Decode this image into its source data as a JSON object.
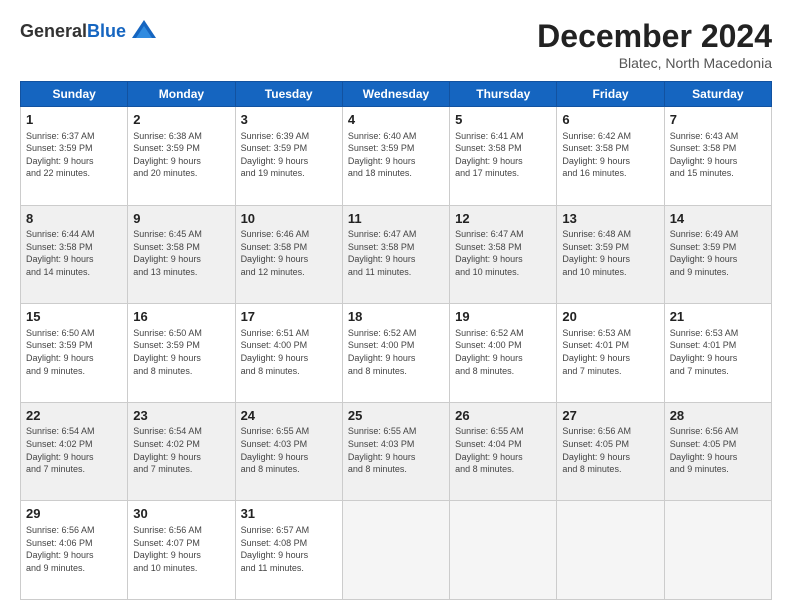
{
  "header": {
    "logo_general": "General",
    "logo_blue": "Blue",
    "month_year": "December 2024",
    "location": "Blatec, North Macedonia"
  },
  "weekdays": [
    "Sunday",
    "Monday",
    "Tuesday",
    "Wednesday",
    "Thursday",
    "Friday",
    "Saturday"
  ],
  "weeks": [
    [
      {
        "day": "1",
        "info": "Sunrise: 6:37 AM\nSunset: 3:59 PM\nDaylight: 9 hours\nand 22 minutes."
      },
      {
        "day": "2",
        "info": "Sunrise: 6:38 AM\nSunset: 3:59 PM\nDaylight: 9 hours\nand 20 minutes."
      },
      {
        "day": "3",
        "info": "Sunrise: 6:39 AM\nSunset: 3:59 PM\nDaylight: 9 hours\nand 19 minutes."
      },
      {
        "day": "4",
        "info": "Sunrise: 6:40 AM\nSunset: 3:59 PM\nDaylight: 9 hours\nand 18 minutes."
      },
      {
        "day": "5",
        "info": "Sunrise: 6:41 AM\nSunset: 3:58 PM\nDaylight: 9 hours\nand 17 minutes."
      },
      {
        "day": "6",
        "info": "Sunrise: 6:42 AM\nSunset: 3:58 PM\nDaylight: 9 hours\nand 16 minutes."
      },
      {
        "day": "7",
        "info": "Sunrise: 6:43 AM\nSunset: 3:58 PM\nDaylight: 9 hours\nand 15 minutes."
      }
    ],
    [
      {
        "day": "8",
        "info": "Sunrise: 6:44 AM\nSunset: 3:58 PM\nDaylight: 9 hours\nand 14 minutes."
      },
      {
        "day": "9",
        "info": "Sunrise: 6:45 AM\nSunset: 3:58 PM\nDaylight: 9 hours\nand 13 minutes."
      },
      {
        "day": "10",
        "info": "Sunrise: 6:46 AM\nSunset: 3:58 PM\nDaylight: 9 hours\nand 12 minutes."
      },
      {
        "day": "11",
        "info": "Sunrise: 6:47 AM\nSunset: 3:58 PM\nDaylight: 9 hours\nand 11 minutes."
      },
      {
        "day": "12",
        "info": "Sunrise: 6:47 AM\nSunset: 3:58 PM\nDaylight: 9 hours\nand 10 minutes."
      },
      {
        "day": "13",
        "info": "Sunrise: 6:48 AM\nSunset: 3:59 PM\nDaylight: 9 hours\nand 10 minutes."
      },
      {
        "day": "14",
        "info": "Sunrise: 6:49 AM\nSunset: 3:59 PM\nDaylight: 9 hours\nand 9 minutes."
      }
    ],
    [
      {
        "day": "15",
        "info": "Sunrise: 6:50 AM\nSunset: 3:59 PM\nDaylight: 9 hours\nand 9 minutes."
      },
      {
        "day": "16",
        "info": "Sunrise: 6:50 AM\nSunset: 3:59 PM\nDaylight: 9 hours\nand 8 minutes."
      },
      {
        "day": "17",
        "info": "Sunrise: 6:51 AM\nSunset: 4:00 PM\nDaylight: 9 hours\nand 8 minutes."
      },
      {
        "day": "18",
        "info": "Sunrise: 6:52 AM\nSunset: 4:00 PM\nDaylight: 9 hours\nand 8 minutes."
      },
      {
        "day": "19",
        "info": "Sunrise: 6:52 AM\nSunset: 4:00 PM\nDaylight: 9 hours\nand 8 minutes."
      },
      {
        "day": "20",
        "info": "Sunrise: 6:53 AM\nSunset: 4:01 PM\nDaylight: 9 hours\nand 7 minutes."
      },
      {
        "day": "21",
        "info": "Sunrise: 6:53 AM\nSunset: 4:01 PM\nDaylight: 9 hours\nand 7 minutes."
      }
    ],
    [
      {
        "day": "22",
        "info": "Sunrise: 6:54 AM\nSunset: 4:02 PM\nDaylight: 9 hours\nand 7 minutes."
      },
      {
        "day": "23",
        "info": "Sunrise: 6:54 AM\nSunset: 4:02 PM\nDaylight: 9 hours\nand 7 minutes."
      },
      {
        "day": "24",
        "info": "Sunrise: 6:55 AM\nSunset: 4:03 PM\nDaylight: 9 hours\nand 8 minutes."
      },
      {
        "day": "25",
        "info": "Sunrise: 6:55 AM\nSunset: 4:03 PM\nDaylight: 9 hours\nand 8 minutes."
      },
      {
        "day": "26",
        "info": "Sunrise: 6:55 AM\nSunset: 4:04 PM\nDaylight: 9 hours\nand 8 minutes."
      },
      {
        "day": "27",
        "info": "Sunrise: 6:56 AM\nSunset: 4:05 PM\nDaylight: 9 hours\nand 8 minutes."
      },
      {
        "day": "28",
        "info": "Sunrise: 6:56 AM\nSunset: 4:05 PM\nDaylight: 9 hours\nand 9 minutes."
      }
    ],
    [
      {
        "day": "29",
        "info": "Sunrise: 6:56 AM\nSunset: 4:06 PM\nDaylight: 9 hours\nand 9 minutes."
      },
      {
        "day": "30",
        "info": "Sunrise: 6:56 AM\nSunset: 4:07 PM\nDaylight: 9 hours\nand 10 minutes."
      },
      {
        "day": "31",
        "info": "Sunrise: 6:57 AM\nSunset: 4:08 PM\nDaylight: 9 hours\nand 11 minutes."
      },
      null,
      null,
      null,
      null
    ]
  ]
}
